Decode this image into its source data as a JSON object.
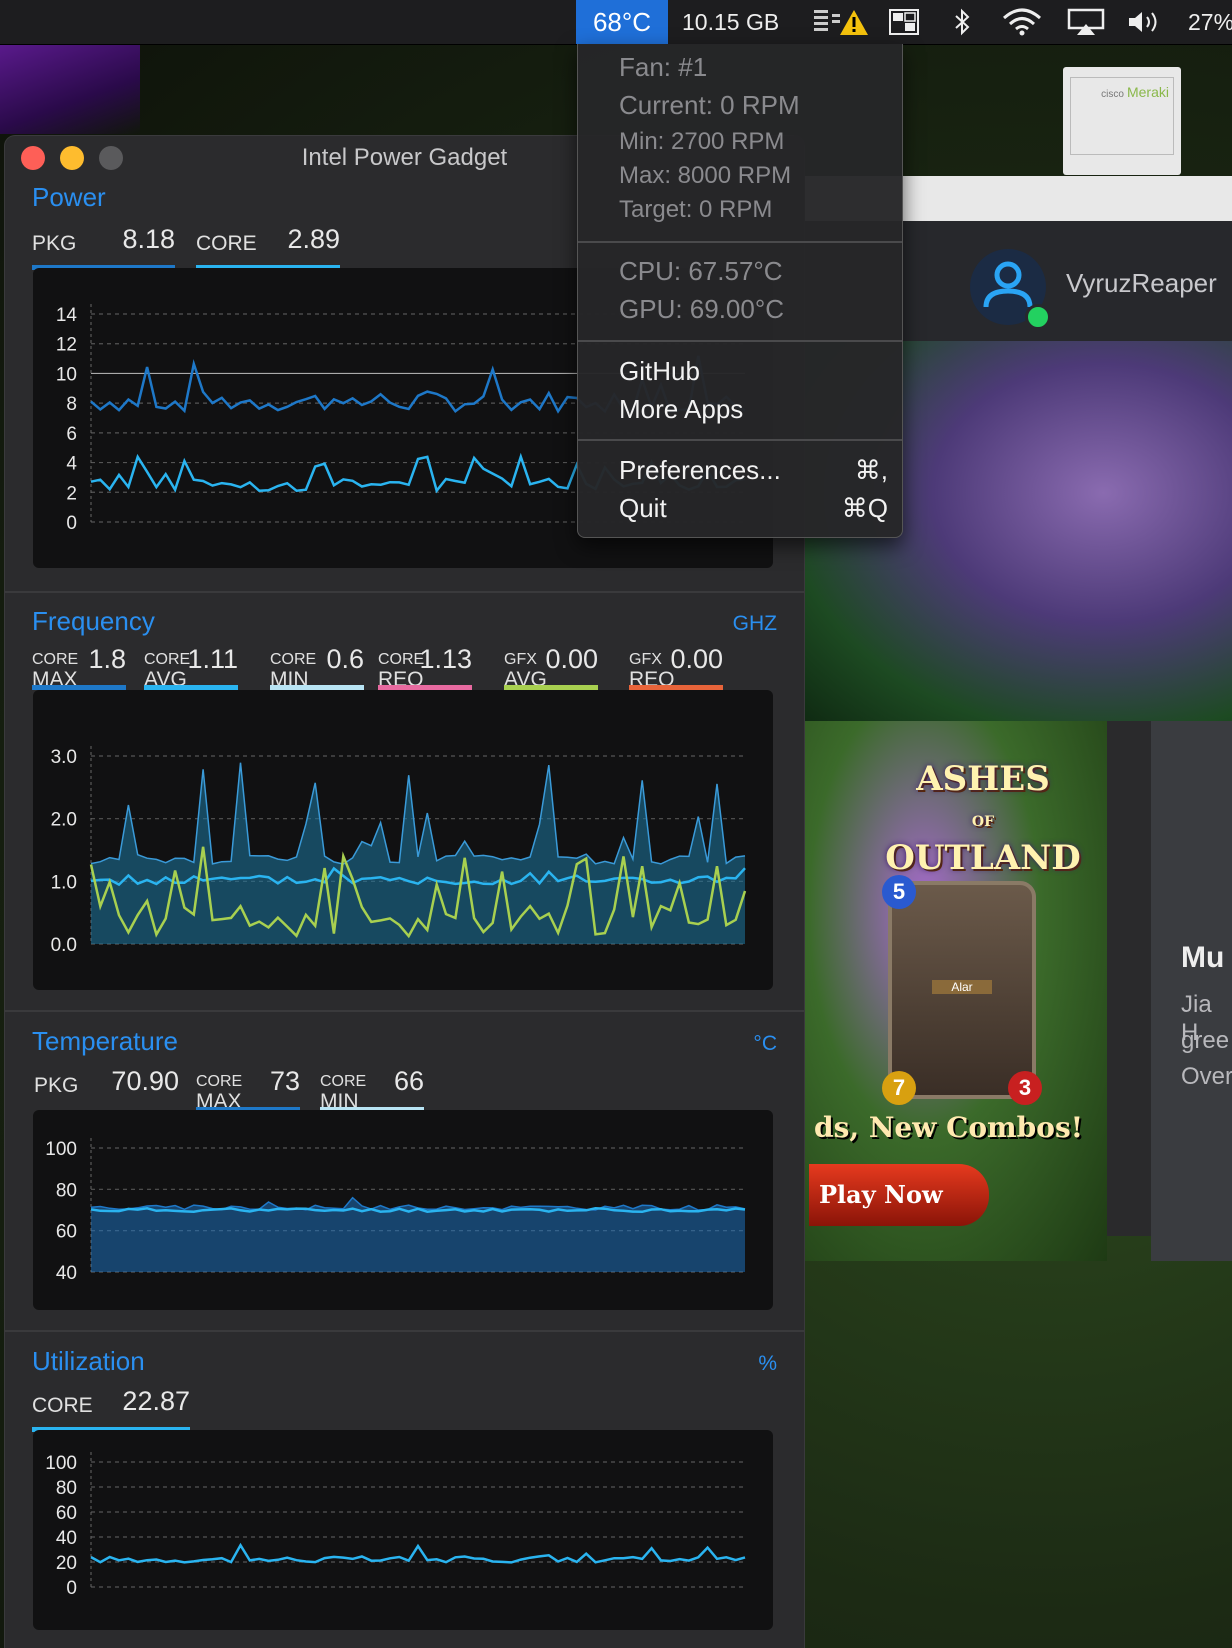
{
  "menubar": {
    "temperature": "68°C",
    "memory": "10.15 GB",
    "battery": "27%",
    "icons": [
      "disk-warning-icon",
      "windows-grid-icon",
      "bluetooth-icon",
      "wifi-icon",
      "airplay-icon",
      "volume-icon"
    ]
  },
  "menu": {
    "fan": "Fan: #1",
    "current": "Current: 0 RPM",
    "min": "Min: 2700 RPM",
    "max": "Max: 8000 RPM",
    "target": "Target: 0 RPM",
    "cpu": "CPU: 67.57°C",
    "gpu": "GPU: 69.00°C",
    "github": "GitHub",
    "more_apps": "More Apps",
    "preferences": "Preferences...",
    "preferences_shortcut": "⌘,",
    "quit": "Quit",
    "quit_shortcut": "⌘Q"
  },
  "background_app": {
    "username": "VyruzReaper",
    "ad_title_1": "ASHES",
    "ad_title_of": "OF",
    "ad_title_2": "OUTLAND",
    "ad_slogan": "ds, New Combos!",
    "ad_button": "Play Now",
    "card_cost": "5",
    "card_attack": "7",
    "card_health": "3",
    "card_name": "Alar",
    "side_title": "Mu",
    "side_lines": [
      "Jia H",
      "gree",
      "Over"
    ],
    "meraki_brand": "Meraki",
    "meraki_cisco": "cisco"
  },
  "window": {
    "title": "Intel Power Gadget",
    "power": {
      "title": "Power",
      "pkg_label": "PKG",
      "pkg_value": "8.18",
      "core_label": "CORE",
      "core_value": "2.89",
      "y_ticks": [
        "14",
        "12",
        "10",
        "8",
        "6",
        "4",
        "2",
        "0"
      ]
    },
    "frequency": {
      "title": "Frequency",
      "unit": "GHZ",
      "stats": [
        {
          "top": "CORE",
          "bottom": "MAX",
          "value": "1.8"
        },
        {
          "top": "CORE",
          "bottom": "AVG",
          "value": "1.11"
        },
        {
          "top": "CORE",
          "bottom": "MIN",
          "value": "0.6"
        },
        {
          "top": "CORE",
          "bottom": "REQ",
          "value": "1.13"
        },
        {
          "top": "GFX",
          "bottom": "AVG",
          "value": "0.00"
        },
        {
          "top": "GFX",
          "bottom": "REQ",
          "value": "0.00"
        }
      ],
      "y_ticks": [
        "3.0",
        "2.0",
        "1.0",
        "0.0"
      ]
    },
    "temperature": {
      "title": "Temperature",
      "unit": "°C",
      "pkg_label": "PKG",
      "pkg_value": "70.90",
      "max_top": "CORE",
      "max_bottom": "MAX",
      "max_value": "73",
      "min_top": "CORE",
      "min_bottom": "MIN",
      "min_value": "66",
      "y_ticks": [
        "100",
        "80",
        "60",
        "40"
      ]
    },
    "utilization": {
      "title": "Utilization",
      "unit": "%",
      "core_label": "CORE",
      "core_value": "22.87",
      "y_ticks": [
        "100",
        "80",
        "60",
        "40",
        "20",
        "0"
      ]
    }
  },
  "colors": {
    "accent_blue": "#2a8ff0",
    "pkg_line": "#1e78c8",
    "core_line": "#2ab4f0",
    "core_min": "#b8e4f4",
    "core_req": "#e86aa0",
    "gfx_avg": "#a8d050",
    "gfx_req": "#e8643a",
    "menu_highlight": "#1f6fd8"
  }
}
